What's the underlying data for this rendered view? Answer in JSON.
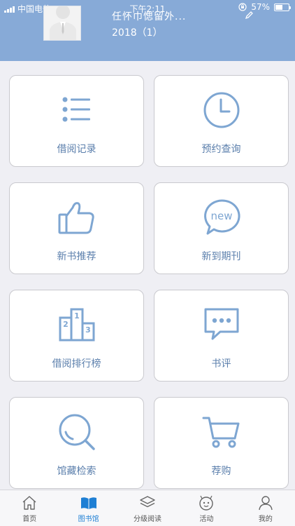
{
  "status_bar": {
    "carrier": "中国电信",
    "time": "下午2:11",
    "battery": "57%",
    "battery_level": 0.57
  },
  "header": {
    "name": "任怀巾愢留外...",
    "class_info": "2018（1）"
  },
  "tiles": [
    {
      "label": "借阅记录",
      "icon": "list-icon"
    },
    {
      "label": "预约查询",
      "icon": "clock-icon"
    },
    {
      "label": "新书推荐",
      "icon": "thumbs-up-icon"
    },
    {
      "label": "新到期刊",
      "icon": "new-bubble-icon"
    },
    {
      "label": "借阅排行榜",
      "icon": "podium-icon"
    },
    {
      "label": "书评",
      "icon": "comment-icon"
    },
    {
      "label": "馆藏检索",
      "icon": "search-icon"
    },
    {
      "label": "荐购",
      "icon": "cart-icon"
    }
  ],
  "podium": {
    "first": "1",
    "second": "2",
    "third": "3"
  },
  "new_badge": "new",
  "tabbar": {
    "items": [
      {
        "label": "首页",
        "icon": "home-icon"
      },
      {
        "label": "图书馆",
        "icon": "book-icon"
      },
      {
        "label": "分级阅读",
        "icon": "layers-icon"
      },
      {
        "label": "活动",
        "icon": "activity-icon"
      },
      {
        "label": "我的",
        "icon": "person-icon"
      }
    ],
    "active_index": 1
  },
  "colors": {
    "header": "#87aad7",
    "icon": "#7ea6d2",
    "label": "#5b7fac",
    "active_tab": "#1e7fd4"
  }
}
